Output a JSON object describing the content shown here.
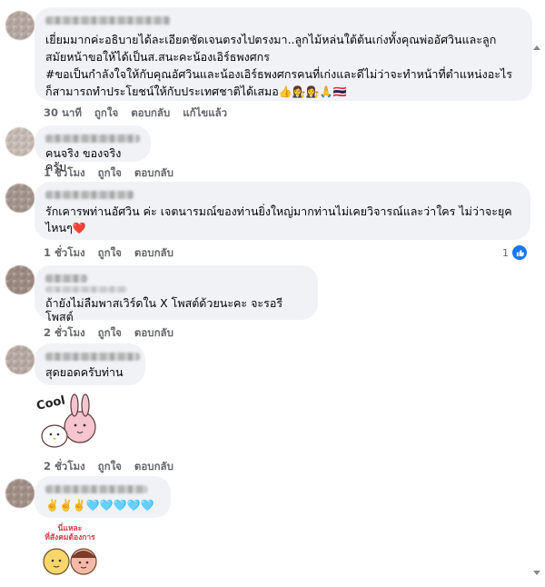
{
  "comments": [
    {
      "text": "เยี่ยมมากค่ะอธิบายได้ละเอียดชัดเจนตรงไปตรงมา..ลูกไม้หล่นใต้ต้นเก่งทั้งคุณพ่ออัศวินและลูก\nสมัยหน้าขอให้ได้เป็นส.สนะคะน้องเอิร์ธพงศกร\n#ขอเป็นกำลังใจให้กับคุณอัศวินและน้องเอิร์ธพงศกรคนที่เก่งและดีไม่ว่าจะทำหน้าที่ตำแหน่งอะไร\nก็สามารถทำประโยชน์ให้กับประเทศชาติได้เสมอ",
      "emoji": "👍👩‍⚖️👩‍⚖️🙏🇹🇭",
      "time": "30 นาที",
      "like": "ถูกใจ",
      "reply": "ตอบกลับ",
      "edited": "แก้ไขแล้ว"
    },
    {
      "text": "คนจริง ของจริงครับ",
      "time": "1 ชั่วโมง",
      "like": "ถูกใจ",
      "reply": "ตอบกลับ"
    },
    {
      "text": "รักเคารพท่านอัศวิน ค่ะ เจตนารมณ์ของท่านยิ่งใหญ่มากท่านไม่เคยวิจารณ์และว่าใคร ไม่ว่าจะยุค\nไหนๆ",
      "emoji": "❤️",
      "time": "1 ชั่วโมง",
      "like": "ถูกใจ",
      "reply": "ตอบกลับ",
      "reaction_count": "1"
    },
    {
      "text": "ถ้ายังไม่ลืมพาสเวิร์ดใน X โพสต์ด้วยนะคะ จะรอรีโพสต์",
      "time": "2 ชั่วโมง",
      "like": "ถูกใจ",
      "reply": "ตอบกลับ"
    },
    {
      "text": "สุดยอดครับท่าน",
      "sticker_text": "Cool",
      "time": "2 ชั่วโมง",
      "like": "ถูกใจ",
      "reply": "ตอบกลับ"
    },
    {
      "emoji": "✌️✌️✌️🩵🩵🩵🩵🩵",
      "sticker_text": "นี่แหละ\nที่สังคมต้องการ"
    }
  ],
  "colors": {
    "bubble": "#f0f2f5",
    "meta": "#65676b",
    "like_blue": "#1877f2",
    "heart": "#e41e3f"
  }
}
